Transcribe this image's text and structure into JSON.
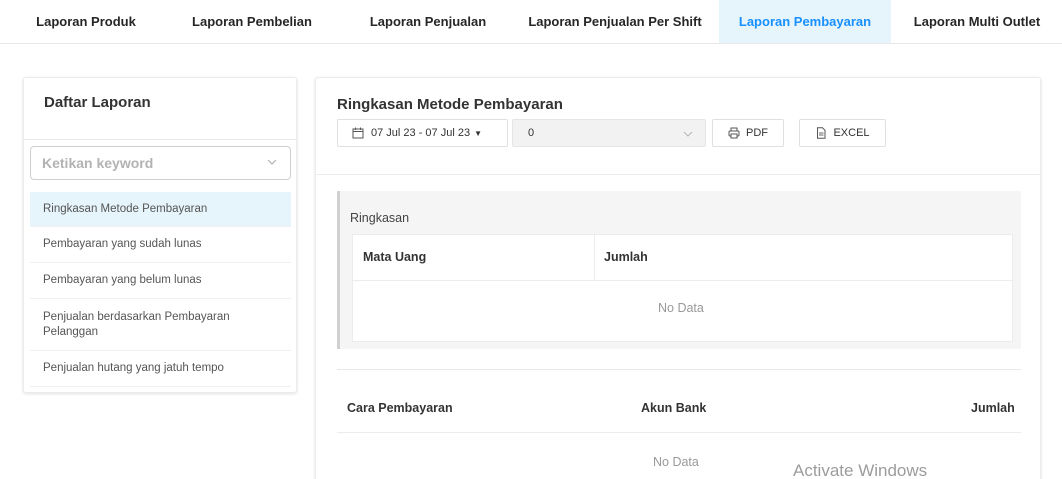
{
  "tabs": [
    {
      "label": "Laporan Produk",
      "active": false
    },
    {
      "label": "Laporan Pembelian",
      "active": false
    },
    {
      "label": "Laporan Penjualan",
      "active": false
    },
    {
      "label": "Laporan Penjualan Per Shift",
      "active": false
    },
    {
      "label": "Laporan Pembayaran",
      "active": true
    },
    {
      "label": "Laporan Multi Outlet",
      "active": false
    }
  ],
  "sidebar": {
    "title": "Daftar Laporan",
    "keyword_placeholder": "Ketikan keyword",
    "items": [
      {
        "label": "Ringkasan Metode Pembayaran",
        "active": true
      },
      {
        "label": "Pembayaran yang sudah lunas",
        "active": false
      },
      {
        "label": "Pembayaran yang belum lunas",
        "active": false
      },
      {
        "label": "Penjualan berdasarkan Pembayaran Pelanggan",
        "active": false
      },
      {
        "label": "Penjualan hutang yang jatuh tempo",
        "active": false
      }
    ]
  },
  "main": {
    "title": "Ringkasan Metode Pembayaran",
    "date_range": "07 Jul 23 - 07 Jul 23",
    "selector_value": "0",
    "pdf_label": "PDF",
    "excel_label": "EXCEL",
    "summary": {
      "label": "Ringkasan",
      "columns": [
        "Mata Uang",
        "Jumlah"
      ],
      "empty_text": "No Data"
    },
    "payments": {
      "columns": [
        "Cara Pembayaran",
        "Akun Bank",
        "Jumlah"
      ],
      "empty_text": "No Data"
    }
  },
  "watermark": "Activate Windows",
  "colors": {
    "accent": "#1890ff",
    "active_bg": "#e6f4fb"
  }
}
